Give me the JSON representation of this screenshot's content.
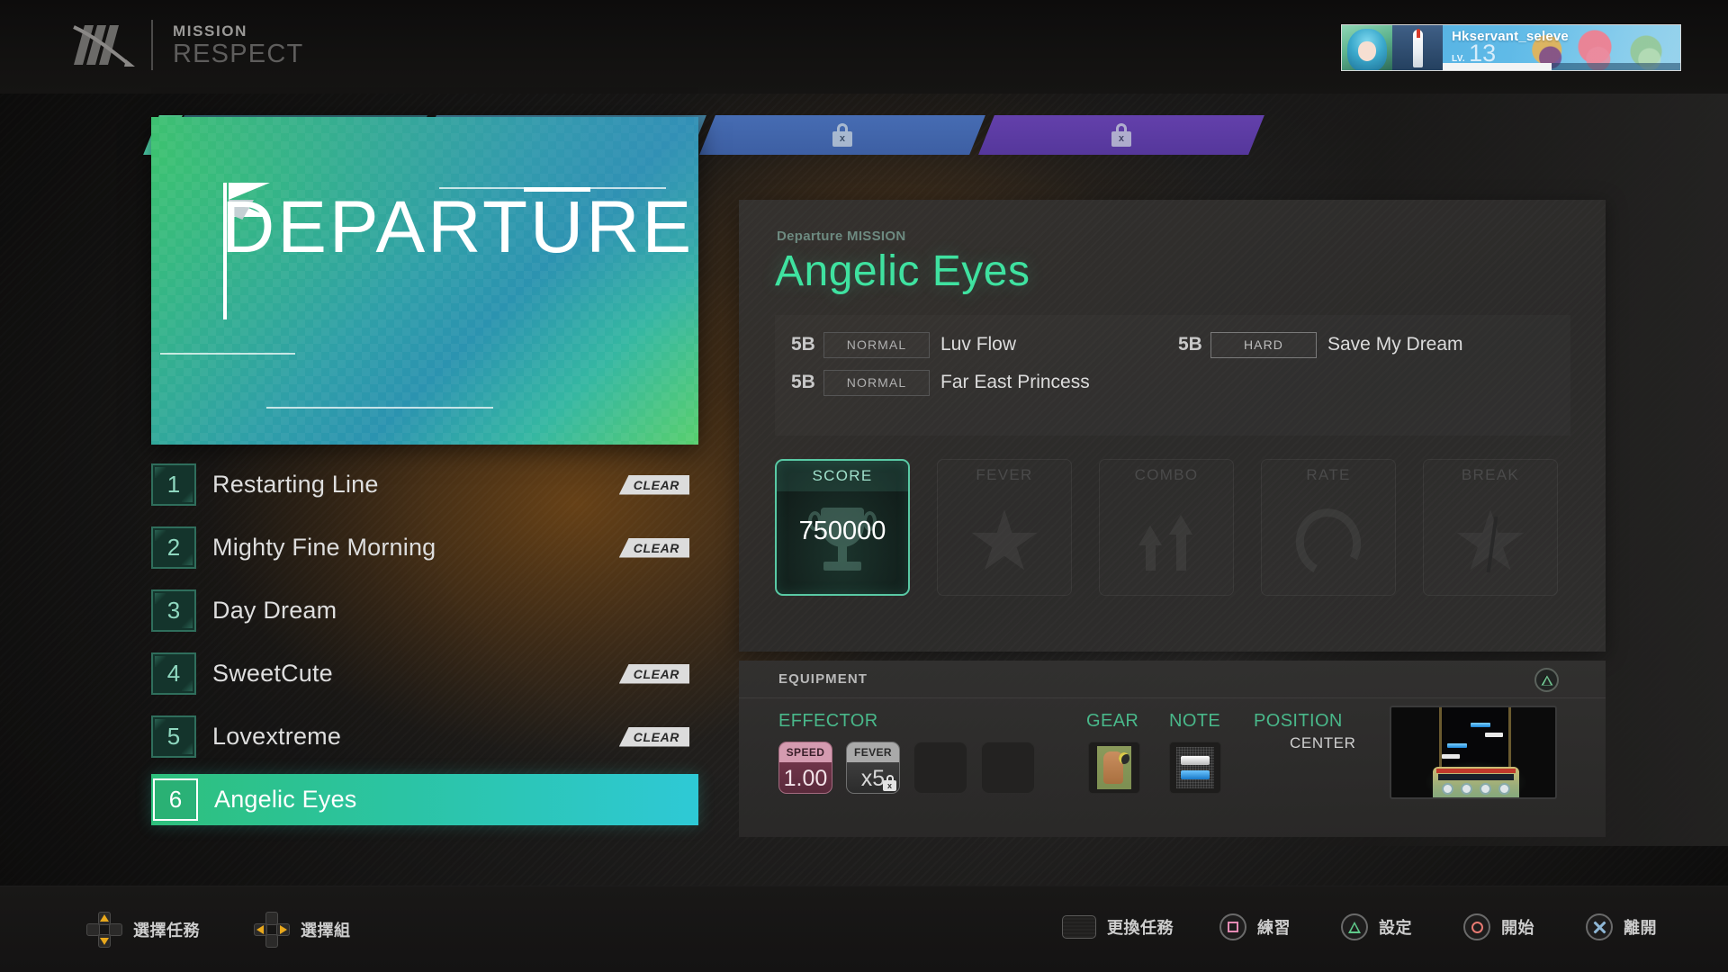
{
  "header": {
    "logo_icon": "respect-slash-logo-icon",
    "mission_label": "MISSION",
    "respect_label": "RESPECT"
  },
  "profile": {
    "avatar_icon": "player-avatar",
    "secondary_icon": "rocket-badge-icon",
    "name": "Hkservant_seleve",
    "level_label": "LV.",
    "level_value": "13"
  },
  "tabs": [
    {
      "name": "tab-departure",
      "state": "active",
      "locked": false,
      "color": "#3ec46b"
    },
    {
      "name": "tab-locked-1",
      "state": "locked",
      "locked": true,
      "color": "#2c6e7d",
      "lock_icon": "lock-x-icon"
    },
    {
      "name": "tab-locked-2",
      "state": "locked",
      "locked": true,
      "color": "#3c7ba3",
      "lock_icon": "lock-x-icon"
    },
    {
      "name": "tab-locked-3",
      "state": "locked",
      "locked": true,
      "color": "#3c64ae",
      "lock_icon": "lock-x-icon"
    },
    {
      "name": "tab-locked-4",
      "state": "locked",
      "locked": true,
      "color": "#5b3e9e",
      "lock_icon": "lock-x-icon"
    }
  ],
  "banner": {
    "title": "DEPARTURE",
    "flag_icon": "flag-icon",
    "gradient_from": "#3ec46b",
    "gradient_to": "#2b93b0"
  },
  "songlist": [
    {
      "num": "1",
      "title": "Restarting Line",
      "badge": "CLEAR",
      "selected": false
    },
    {
      "num": "2",
      "title": "Mighty Fine Morning",
      "badge": "CLEAR",
      "selected": false
    },
    {
      "num": "3",
      "title": "Day Dream",
      "badge": "",
      "selected": false
    },
    {
      "num": "4",
      "title": "SweetCute",
      "badge": "CLEAR",
      "selected": false
    },
    {
      "num": "5",
      "title": "Lovextreme",
      "badge": "CLEAR",
      "selected": false
    },
    {
      "num": "6",
      "title": "Angelic Eyes",
      "badge": "",
      "selected": true
    }
  ],
  "mission": {
    "kicker": "Departure MISSION",
    "title": "Angelic Eyes",
    "requirements": [
      {
        "buttons": "5B",
        "difficulty": "NORMAL",
        "song": "Luv Flow"
      },
      {
        "buttons": "5B",
        "difficulty": "HARD",
        "song": "Save My Dream"
      },
      {
        "buttons": "5B",
        "difficulty": "NORMAL",
        "song": "Far East Princess"
      }
    ],
    "conditions": [
      {
        "label": "SCORE",
        "value": "750000",
        "icon": "trophy-icon",
        "active": true
      },
      {
        "label": "FEVER",
        "value": "",
        "icon": "star-icon",
        "active": false
      },
      {
        "label": "COMBO",
        "value": "",
        "icon": "combo-arrows-icon",
        "active": false
      },
      {
        "label": "RATE",
        "value": "",
        "icon": "rate-ring-icon",
        "active": false
      },
      {
        "label": "BREAK",
        "value": "",
        "icon": "broken-star-icon",
        "active": false
      }
    ]
  },
  "equipment": {
    "panel_title": "EQUIPMENT",
    "options_button_icon": "triangle-button-icon",
    "effector_label": "EFFECTOR",
    "gear_label": "GEAR",
    "note_label": "NOTE",
    "position_label": "POSITION",
    "position_value": "CENTER",
    "effectors": [
      {
        "name": "SPEED",
        "value": "1.00",
        "locked": false,
        "color": "#d49bb0"
      },
      {
        "name": "FEVER",
        "value": "x5",
        "locked": true,
        "color": "#a9a9a9",
        "lock_icon": "lock-x-icon"
      },
      {
        "name": "",
        "value": "",
        "locked": false
      },
      {
        "name": "",
        "value": "",
        "locked": false
      }
    ],
    "gear_icon": "gear-thumbnail-icon",
    "note_icon": "note-skin-thumbnail-icon",
    "position_preview_icon": "gameplay-position-preview"
  },
  "footer": {
    "left_actions": [
      {
        "icon": "dpad-up-down-icon",
        "label": "選擇任務"
      },
      {
        "icon": "dpad-left-right-icon",
        "label": "選擇組"
      }
    ],
    "right_actions": [
      {
        "icon": "touchpad-icon",
        "label": "更換任務"
      },
      {
        "icon": "square-button-icon",
        "label": "練習"
      },
      {
        "icon": "triangle-button-icon",
        "label": "設定"
      },
      {
        "icon": "circle-button-icon",
        "label": "開始"
      },
      {
        "icon": "cross-button-icon",
        "label": "離開"
      }
    ]
  }
}
